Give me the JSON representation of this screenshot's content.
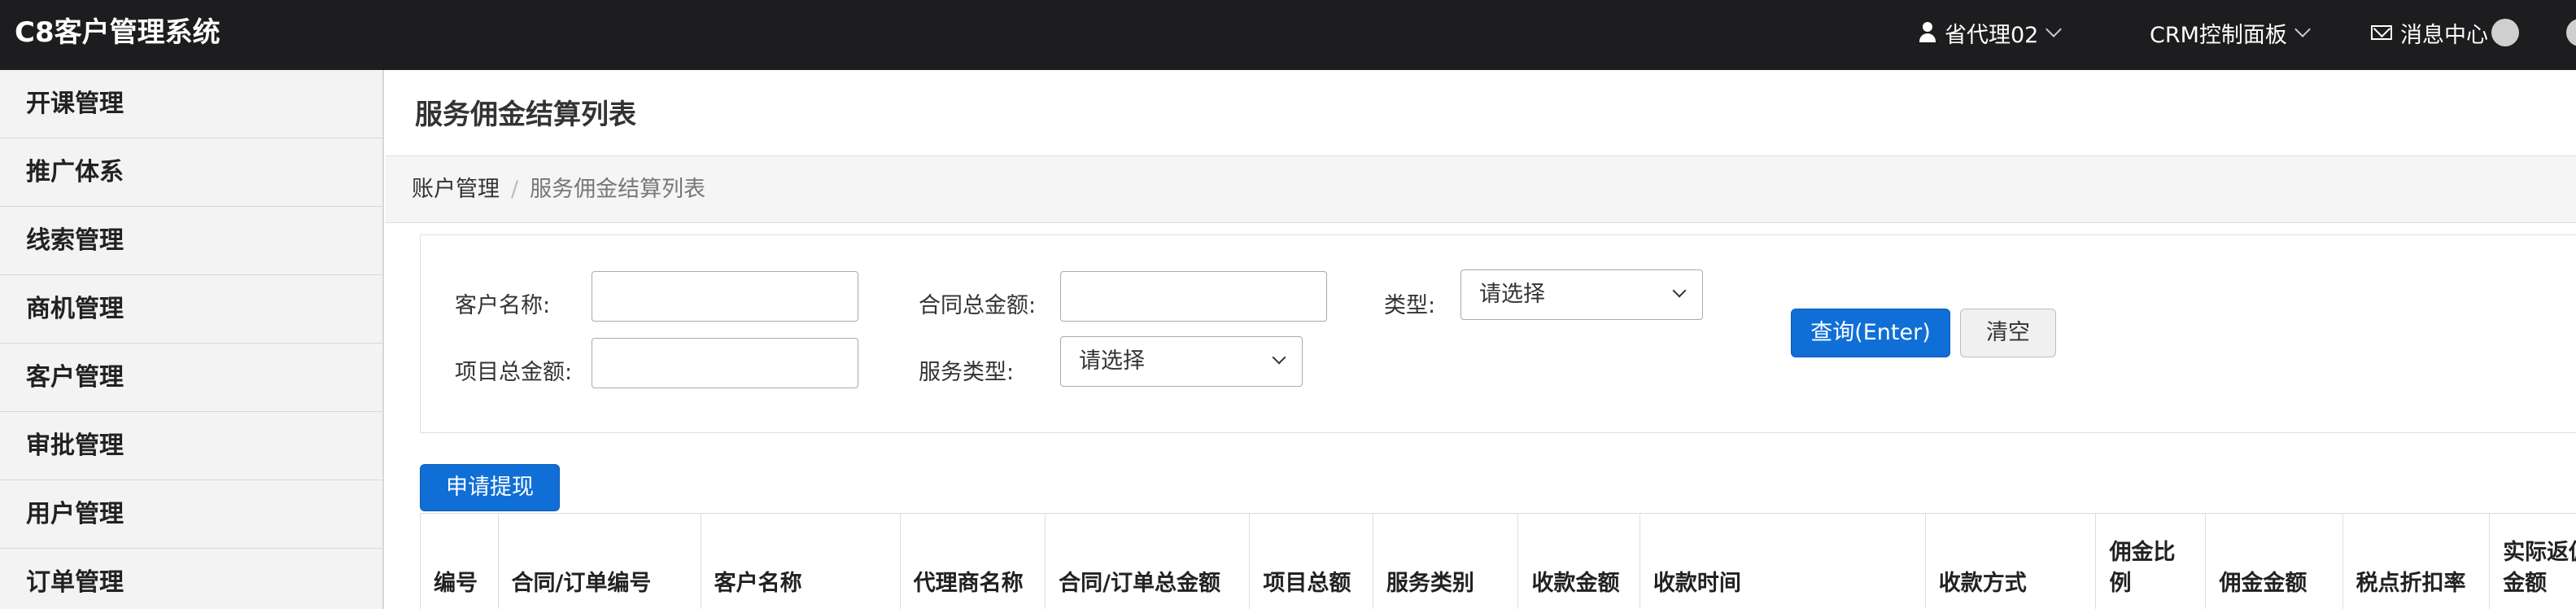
{
  "app": {
    "title": "C8客户管理系统"
  },
  "topnav": {
    "user_label": "省代理02",
    "crm_label": "CRM控制面板",
    "msg_label": "消息中心"
  },
  "sidebar": {
    "items": [
      {
        "label": "开课管理"
      },
      {
        "label": "推广体系"
      },
      {
        "label": "线索管理"
      },
      {
        "label": "商机管理"
      },
      {
        "label": "客户管理"
      },
      {
        "label": "审批管理"
      },
      {
        "label": "用户管理"
      },
      {
        "label": "订单管理"
      }
    ]
  },
  "page": {
    "title": "服务佣金结算列表",
    "breadcrumb": [
      "账户管理",
      "/",
      "服务佣金结算列表"
    ]
  },
  "search": {
    "customer_name_label": "客户名称:",
    "customer_name_value": "",
    "contract_total_label": "合同总金额:",
    "contract_total_value": "",
    "type_label": "类型:",
    "type_value": "请选择",
    "project_total_label": "项目总金额:",
    "project_total_value": "",
    "service_type_label": "服务类型:",
    "service_type_value": "请选择",
    "query_button": "查询(Enter)",
    "clear_button": "清空"
  },
  "actions": {
    "apply_withdraw": "申请提现"
  },
  "table": {
    "columns": [
      "编号",
      "合同/订单编号",
      "客户名称",
      "代理商名称",
      "合同/订单总金额",
      "项目总额",
      "服务类别",
      "收款金额",
      "收款时间",
      "收款方式",
      "佣金比例",
      "佣金金额",
      "税点折扣率",
      "实际返佣金额"
    ]
  },
  "colors": {
    "topbar": "#1d1d1f",
    "primary": "#0f6fd6",
    "sidebar_bg": "#f3f3f3"
  }
}
